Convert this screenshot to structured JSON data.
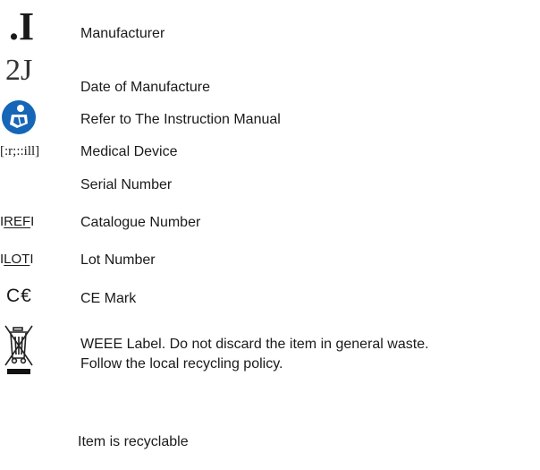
{
  "symbols": [
    {
      "key": "manufacturer",
      "symbol_text": ".I",
      "label": "Manufacturer"
    },
    {
      "key": "date",
      "symbol_text": "2J",
      "label": "Date of Manufacture"
    },
    {
      "key": "manual",
      "icon": "instruction-manual-icon",
      "color": "#1565b8",
      "label": "Refer to The Instruction Manual"
    },
    {
      "key": "medical",
      "symbol_text": "[:r;::ill]",
      "label": "Medical Device"
    },
    {
      "key": "serial",
      "label": "Serial Number"
    },
    {
      "key": "ref",
      "symbol_text": "REF",
      "symbol_prefix": "I",
      "symbol_suffix": "I",
      "label": "Catalogue Number"
    },
    {
      "key": "lot",
      "symbol_text": "LOT",
      "symbol_prefix": "I",
      "symbol_suffix": "I",
      "label": "Lot Number"
    },
    {
      "key": "ce",
      "symbol_text": "C€",
      "label": "CE Mark"
    },
    {
      "key": "weee",
      "icon": "crossed-out-bin-icon",
      "label_line1": "WEEE Label. Do not discard the item in general waste.",
      "label_line2": "Follow the local recycling policy."
    },
    {
      "key": "recyclable",
      "label": "Item is recyclable"
    }
  ]
}
